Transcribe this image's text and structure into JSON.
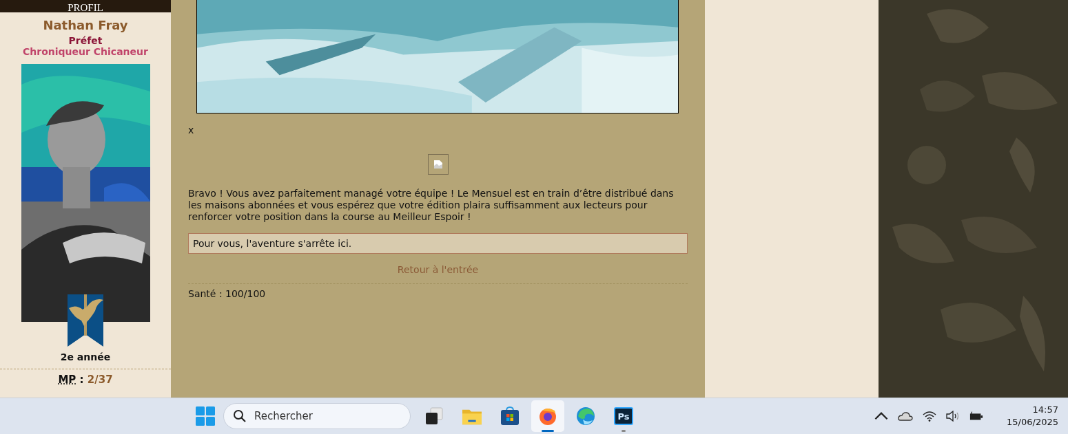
{
  "sidebar": {
    "header": "PROFIL",
    "name": "Nathan Fray",
    "role": "Préfet",
    "title": "Chroniqueur Chicaneur",
    "year": "2e année",
    "stats": [
      {
        "label": "MP",
        "separator": " : ",
        "value": "2/37"
      }
    ]
  },
  "content": {
    "marker": "x",
    "paragraph": "Bravo ! Vous avez parfaitement managé votre équipe ! Le Mensuel est en train d’être distribué dans les maisons abonnées et vous espérez que votre édition plaira suffisamment aux lecteurs pour renforcer votre position dans la course au Meilleur Espoir !",
    "notice": "Pour vous, l'aventure s'arrête ici.",
    "link": "Retour à l'entrée",
    "health": "Santé : 100/100"
  },
  "taskbar": {
    "search": {
      "placeholder": "Rechercher"
    },
    "apps": [
      {
        "kind": "taskview",
        "selected": false,
        "running": false
      },
      {
        "kind": "folder",
        "selected": false,
        "running": false
      },
      {
        "kind": "store",
        "selected": false,
        "running": false
      },
      {
        "kind": "browser-fox",
        "selected": true,
        "running": true
      },
      {
        "kind": "browser-wave",
        "selected": false,
        "running": false
      },
      {
        "kind": "ps",
        "selected": false,
        "running": true,
        "label": "Ps"
      }
    ],
    "time": "14:57",
    "date": "15/06/2025"
  }
}
